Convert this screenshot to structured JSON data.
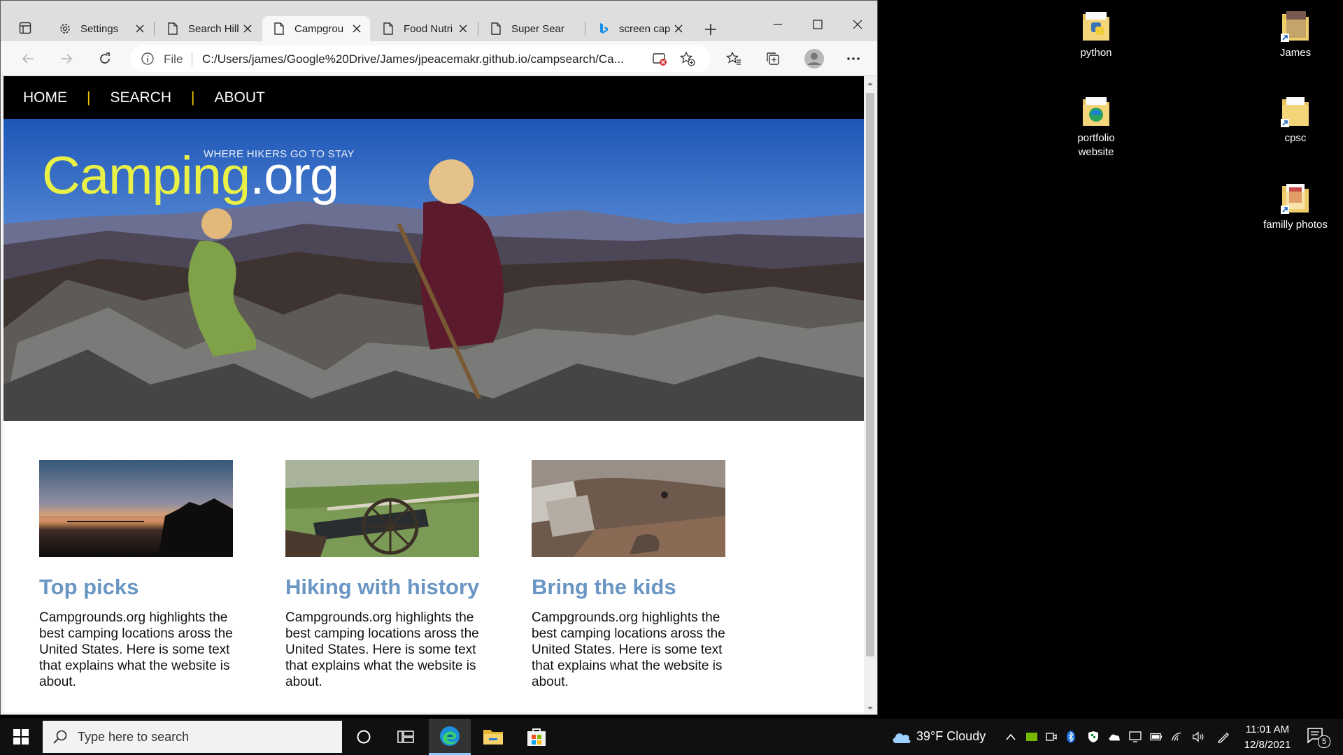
{
  "browser": {
    "tabs": [
      {
        "title": "Settings",
        "icon": "gear-icon",
        "active": false
      },
      {
        "title": "Search Hill",
        "icon": "page-icon",
        "active": false
      },
      {
        "title": "Campgrou",
        "icon": "page-icon",
        "active": true
      },
      {
        "title": "Food Nutri",
        "icon": "page-icon",
        "active": false
      },
      {
        "title": "Super Sear",
        "icon": "page-icon",
        "active": false
      },
      {
        "title": "screen cap",
        "icon": "bing-icon",
        "active": false
      }
    ],
    "address": {
      "scheme_label": "File",
      "url": "C:/Users/james/Google%20Drive/James/jpeacemakr.github.io/campsearch/Ca..."
    }
  },
  "site": {
    "nav": [
      "HOME",
      "SEARCH",
      "ABOUT"
    ],
    "nav_separator": "|",
    "hero": {
      "tagline": "WHERE HIKERS GO TO STAY",
      "logo_main": "Camping",
      "logo_suffix": ".org"
    },
    "cards": [
      {
        "title": "Top picks",
        "text": "Campgrounds.org highlights the best camping locations aross the United States. Here is some text that explains what the website is about."
      },
      {
        "title": "Hiking with history",
        "text": "Campgrounds.org highlights the best camping locations aross the United States. Here is some text that explains what the website is about."
      },
      {
        "title": "Bring the kids",
        "text": "Campgrounds.org highlights the best camping locations aross the United States. Here is some text that explains what the website is about."
      }
    ]
  },
  "desktop": {
    "icons": [
      "python",
      "James",
      "portfolio website",
      "cpsc",
      "familly photos"
    ]
  },
  "taskbar": {
    "search_placeholder": "Type here to search",
    "weather": "39°F  Cloudy",
    "time": "11:01 AM",
    "date": "12/8/2021",
    "notifications": "5"
  },
  "colors": {
    "logo_yellow": "#e9f046",
    "nav_separator": "#f0c400",
    "card_title": "#6a96c4"
  }
}
